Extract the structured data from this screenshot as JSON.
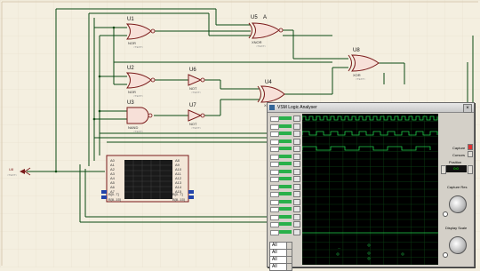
{
  "schematic": {
    "gates": [
      {
        "ref": "U1",
        "type": "NOR",
        "text": "<TEXT>"
      },
      {
        "ref": "U2",
        "type": "NOR",
        "text": "<TEXT>"
      },
      {
        "ref": "U3",
        "type": "NAND",
        "text": "<TEXT>"
      },
      {
        "ref": "U5",
        "type": "XNOR",
        "text": "<TEXT>",
        "label_a": "A"
      },
      {
        "ref": "U6",
        "type": "NOT",
        "text": "<TEXT>"
      },
      {
        "ref": "U7",
        "type": "NOT",
        "text": "<TEXT>"
      },
      {
        "ref": "U4",
        "type": "XOR",
        "text": "<TEXT>"
      },
      {
        "ref": "U8",
        "type": "XOR",
        "text": "<TEXT>"
      }
    ],
    "bus_label": {
      "name": "U8",
      "text": "<TEXT>"
    },
    "pattern_generator": {
      "left_pins": [
        "A0",
        "A1",
        "A2",
        "A3",
        "A4",
        "A5",
        "A6",
        "A7"
      ],
      "right_pins": [
        "A8",
        "A9",
        "A10",
        "A11",
        "A12",
        "A13",
        "A14",
        "A15"
      ],
      "bottom_left": [
        "B[0..7]",
        "B[8..15]"
      ],
      "bottom_right": [
        "B[0..7]",
        "B[8..15]"
      ]
    }
  },
  "logic_analyzer": {
    "title": "VSM Logic Analyser",
    "close": "×",
    "display_label": "—",
    "selects": [
      "All",
      "All",
      "All",
      "All"
    ],
    "controls": {
      "capture": "Capture",
      "cursors": "Cursors",
      "position": "Position",
      "time_display": "0:0",
      "capture_res": "Capture Res",
      "display_scale": "Display Scale"
    }
  }
}
